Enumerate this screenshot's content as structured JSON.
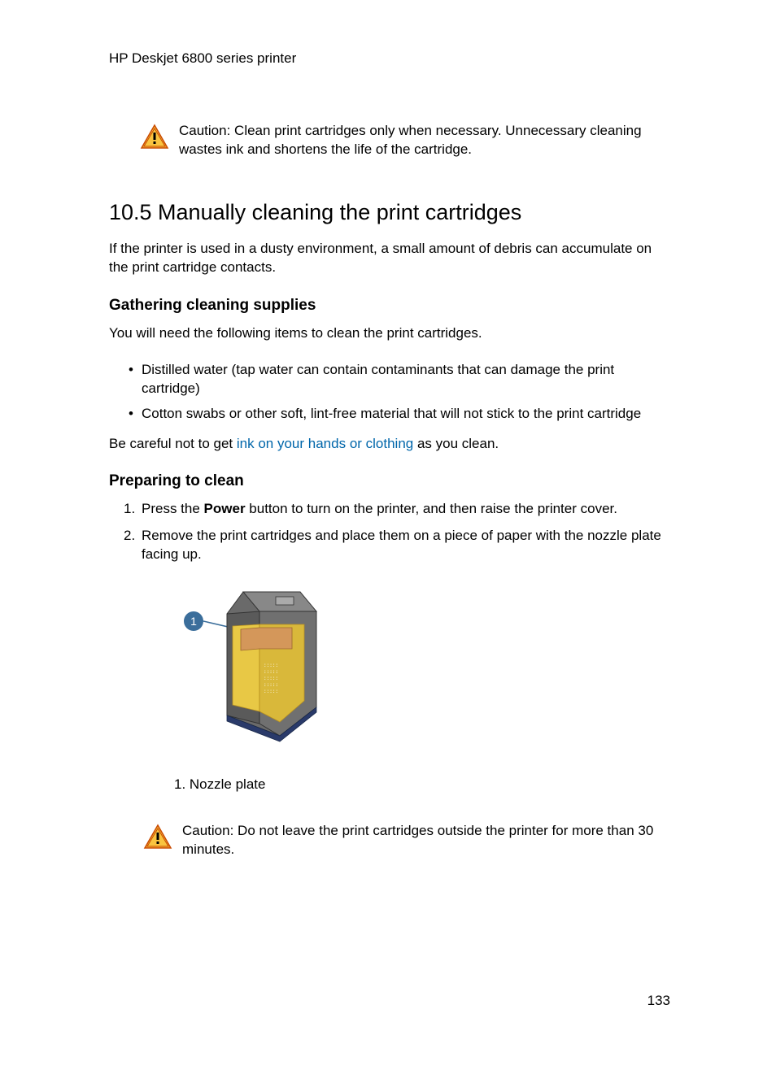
{
  "header": "HP Deskjet 6800 series printer",
  "caution1": {
    "label": "Caution: ",
    "text": "Clean print cartridges only when necessary. Unnecessary cleaning wastes ink and shortens the life of the cartridge."
  },
  "section": {
    "heading": "10.5  Manually cleaning the print cartridges",
    "intro": "If the printer is used in a dusty environment, a small amount of debris can accumulate on the print cartridge contacts."
  },
  "subsection1": {
    "heading": "Gathering cleaning supplies",
    "intro": "You will need the following items to clean the print cartridges.",
    "bullets": [
      "Distilled water (tap water can contain contaminants that can damage the print cartridge)",
      "Cotton swabs or other soft, lint-free material that will not stick to the print cartridge"
    ],
    "footer_prefix": "Be careful not to get ",
    "footer_link": "ink on your hands or clothing",
    "footer_suffix": " as you clean."
  },
  "subsection2": {
    "heading": "Preparing to clean",
    "step1_prefix": "Press the ",
    "step1_bold": "Power",
    "step1_suffix": " button to turn on the printer, and then raise the printer cover.",
    "step2": "Remove the print cartridges and place them on a piece of paper with the nozzle plate facing up.",
    "caption": "1. Nozzle plate"
  },
  "caution2": {
    "label": "Caution: ",
    "text": "Do not leave the print cartridges outside the printer for more than 30 minutes."
  },
  "page_number": "133"
}
